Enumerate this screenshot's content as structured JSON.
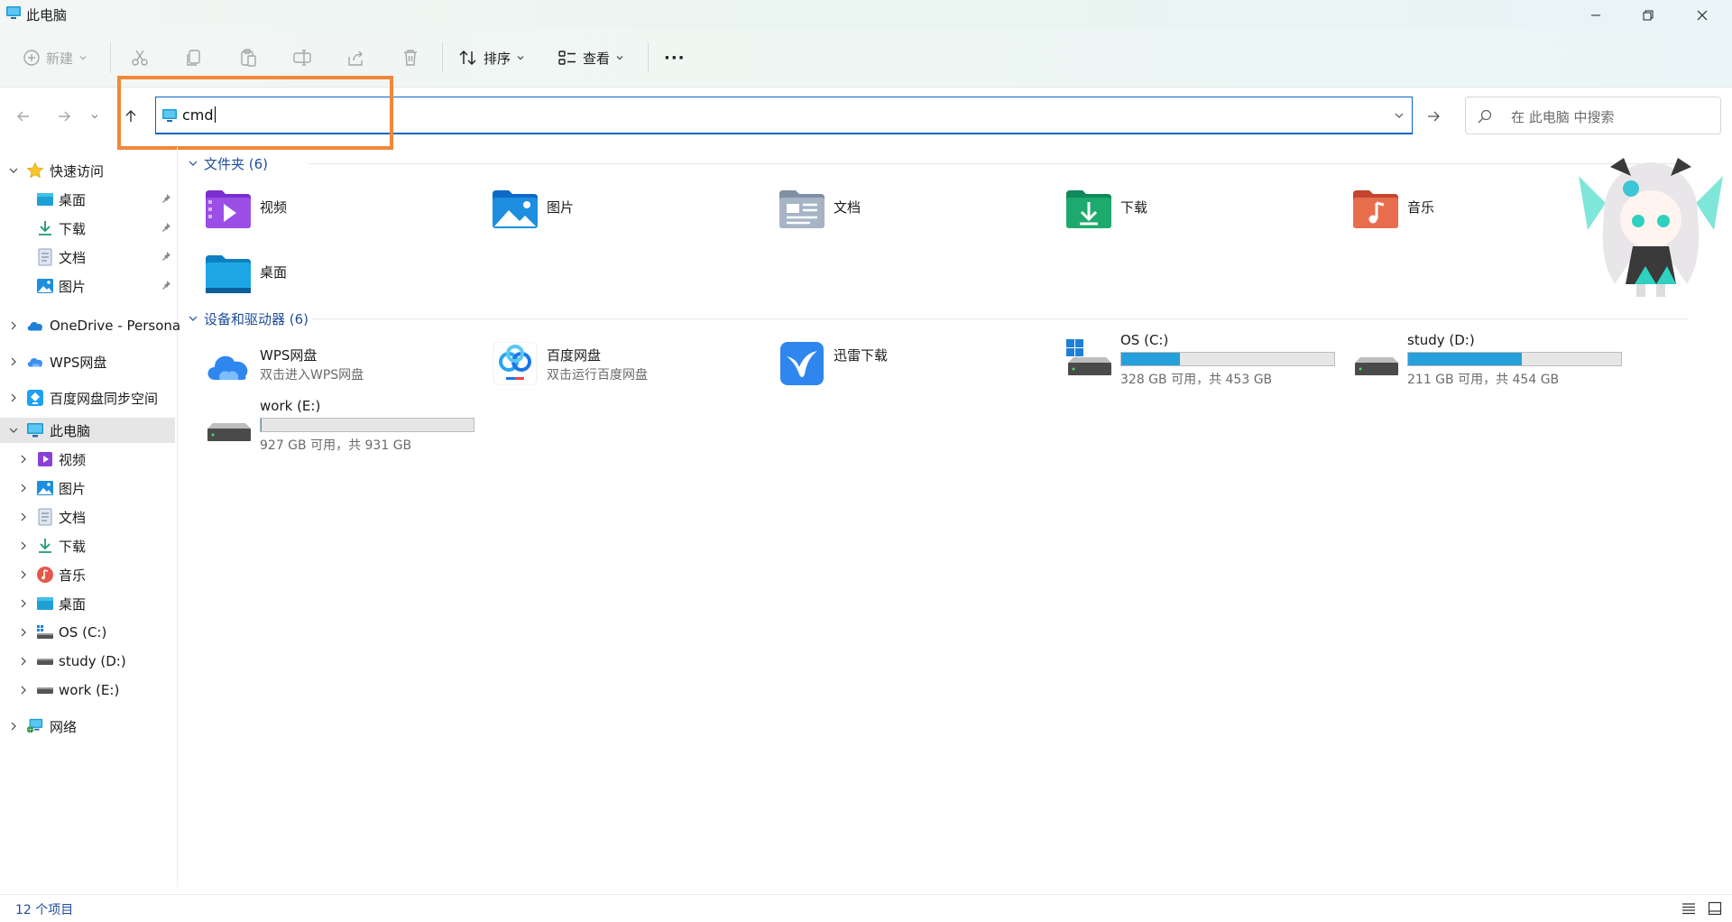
{
  "window": {
    "title": "此电脑"
  },
  "ribbon": {
    "new_label": "新建",
    "sort_label": "排序",
    "view_label": "查看",
    "more_label": "···"
  },
  "address": {
    "value": "cmd",
    "search_placeholder": "在 此电脑 中搜索"
  },
  "sidebar": {
    "quick_access": "快速访问",
    "quick_items": [
      "桌面",
      "下载",
      "文档",
      "图片"
    ],
    "onedrive": "OneDrive - Persona",
    "wps": "WPS网盘",
    "baidu_sync": "百度网盘同步空间",
    "this_pc": "此电脑",
    "pc_items": [
      "视频",
      "图片",
      "文档",
      "下载",
      "音乐",
      "桌面",
      "OS (C:)",
      "study (D:)",
      "work (E:)"
    ],
    "network": "网络"
  },
  "main": {
    "folders_header": "文件夹 (6)",
    "folders": [
      "视频",
      "图片",
      "文档",
      "下载",
      "音乐",
      "桌面"
    ],
    "devices_header": "设备和驱动器 (6)",
    "apps": [
      {
        "name": "WPS网盘",
        "sub": "双击进入WPS网盘"
      },
      {
        "name": "百度网盘",
        "sub": "双击运行百度网盘"
      },
      {
        "name": "迅雷下载",
        "sub": ""
      }
    ],
    "drives": [
      {
        "name": "OS (C:)",
        "free": "328 GB 可用，共 453 GB",
        "used_fraction": 0.276
      },
      {
        "name": "study (D:)",
        "free": "211 GB 可用，共 454 GB",
        "used_fraction": 0.535
      },
      {
        "name": "work (E:)",
        "free": "927 GB 可用，共 931 GB",
        "used_fraction": 0.004
      }
    ]
  },
  "status": {
    "count": "12 个项目"
  },
  "colors": {
    "accent": "#0067c0",
    "highlight": "#f0883a",
    "drive_fill": "#26a0da",
    "group_header": "#1f4e9a"
  }
}
